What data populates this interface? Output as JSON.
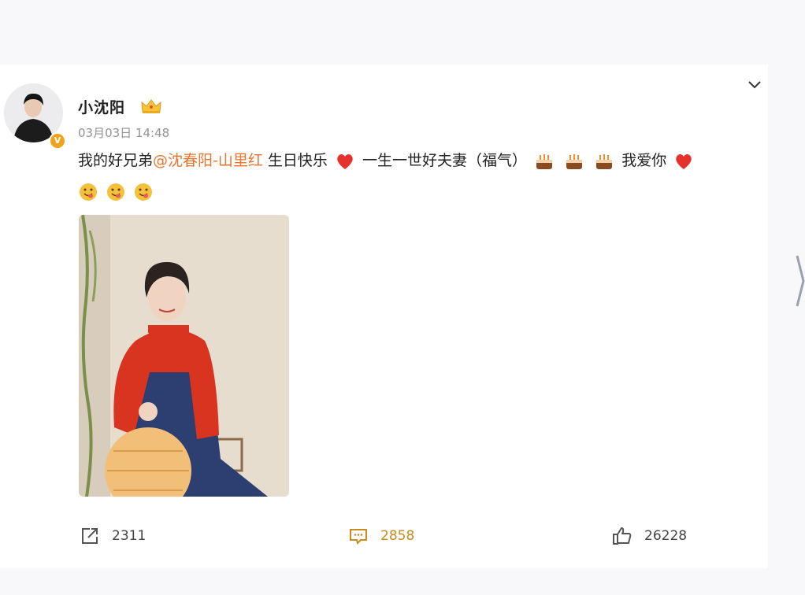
{
  "post": {
    "author": "小沈阳",
    "verified_badge": "V",
    "timestamp": "03月03日 14:48",
    "text_intro": "我的好兄弟",
    "mention": "@沈春阳-山里红",
    "text_birthday": " 生日快乐",
    "text_blessing": " 一生一世好夫妻（福气）",
    "text_love": "我爱你",
    "emoji_icons": [
      "red-heart-icon",
      "birthday-cake-icon",
      "birthday-cake-icon",
      "birthday-cake-icon",
      "red-heart-icon",
      "hungry-face-icon",
      "hungry-face-icon",
      "hungry-face-icon"
    ]
  },
  "actions": {
    "repost_count": "2311",
    "comment_count": "2858",
    "like_count": "26228"
  },
  "colors": {
    "mention": "#e8742e",
    "comment_accent": "#c98a1e",
    "timestamp": "#939393",
    "verified": "#f2a21a"
  }
}
